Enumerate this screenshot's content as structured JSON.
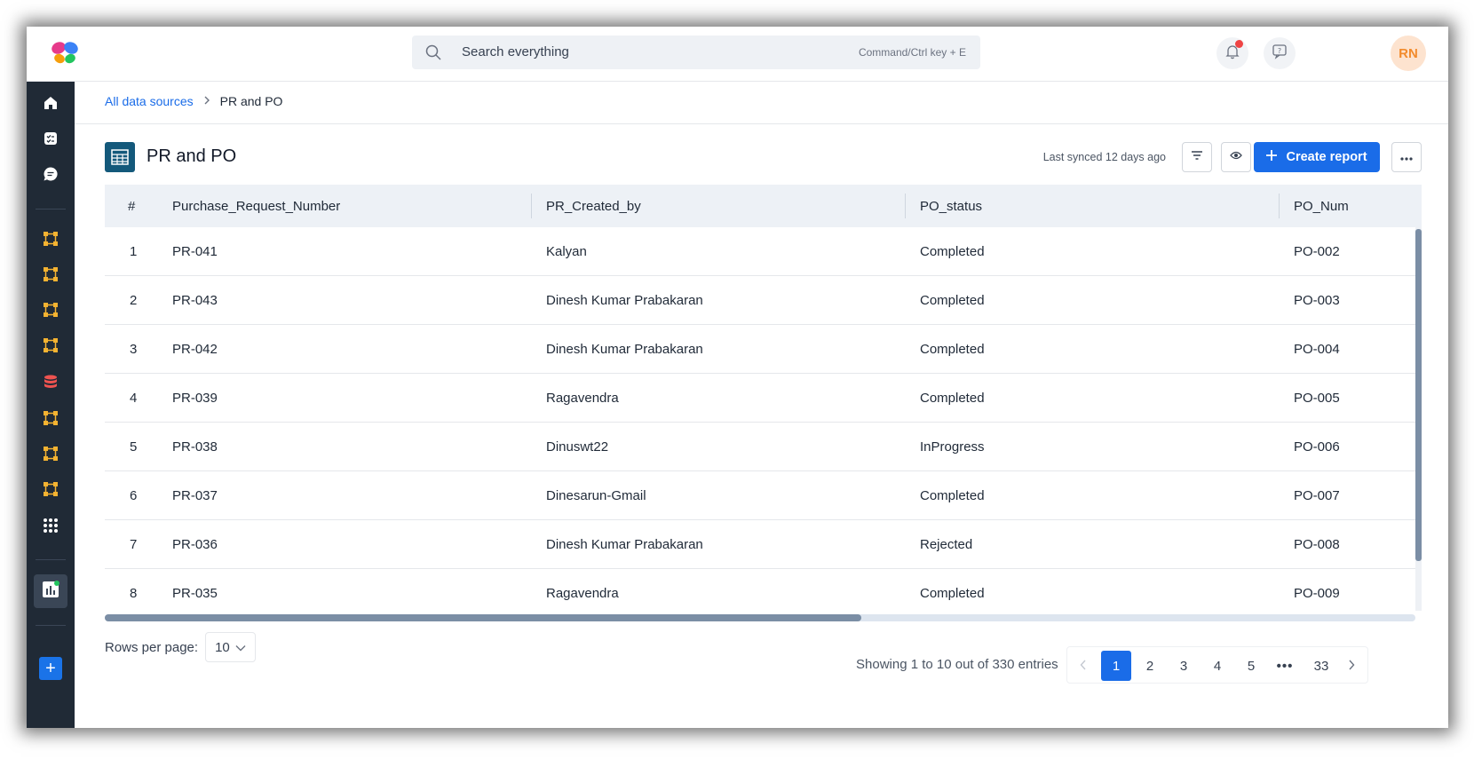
{
  "search": {
    "placeholder": "Search everything",
    "shortcut_hint": "Command/Ctrl key + E"
  },
  "user": {
    "initials": "RN"
  },
  "breadcrumb": {
    "parent": "All data sources",
    "current": "PR and PO"
  },
  "page": {
    "title": "PR and PO",
    "last_synced": "Last synced 12 days ago",
    "create_report_label": "Create report"
  },
  "table": {
    "columns": [
      "#",
      "Purchase_Request_Number",
      "PR_Created_by",
      "PO_status",
      "PO_Num"
    ],
    "rows": [
      [
        "1",
        "PR-041",
        "Kalyan",
        "Completed",
        "PO-002"
      ],
      [
        "2",
        "PR-043",
        "Dinesh Kumar Prabakaran",
        "Completed",
        "PO-003"
      ],
      [
        "3",
        "PR-042",
        "Dinesh Kumar Prabakaran",
        "Completed",
        "PO-004"
      ],
      [
        "4",
        "PR-039",
        "Ragavendra",
        "Completed",
        "PO-005"
      ],
      [
        "5",
        "PR-038",
        "Dinuswt22",
        "InProgress",
        "PO-006"
      ],
      [
        "6",
        "PR-037",
        "Dinesarun-Gmail",
        "Completed",
        "PO-007"
      ],
      [
        "7",
        "PR-036",
        "Dinesh Kumar Prabakaran",
        "Rejected",
        "PO-008"
      ],
      [
        "8",
        "PR-035",
        "Ragavendra",
        "Completed",
        "PO-009"
      ]
    ]
  },
  "footer": {
    "rows_per_page_label": "Rows per page:",
    "rows_per_page_value": "10",
    "showing_text": "Showing 1 to 10 out of 330 entries",
    "pages": [
      "1",
      "2",
      "3",
      "4",
      "5"
    ],
    "ellipsis": "•••",
    "last_page": "33",
    "current_page": "1"
  },
  "colors": {
    "accent": "#1a6ce8",
    "sidebar": "#202a36",
    "header_bg": "#edf1f6",
    "icon_yellow": "#f5b331",
    "icon_red": "#ef5350"
  }
}
